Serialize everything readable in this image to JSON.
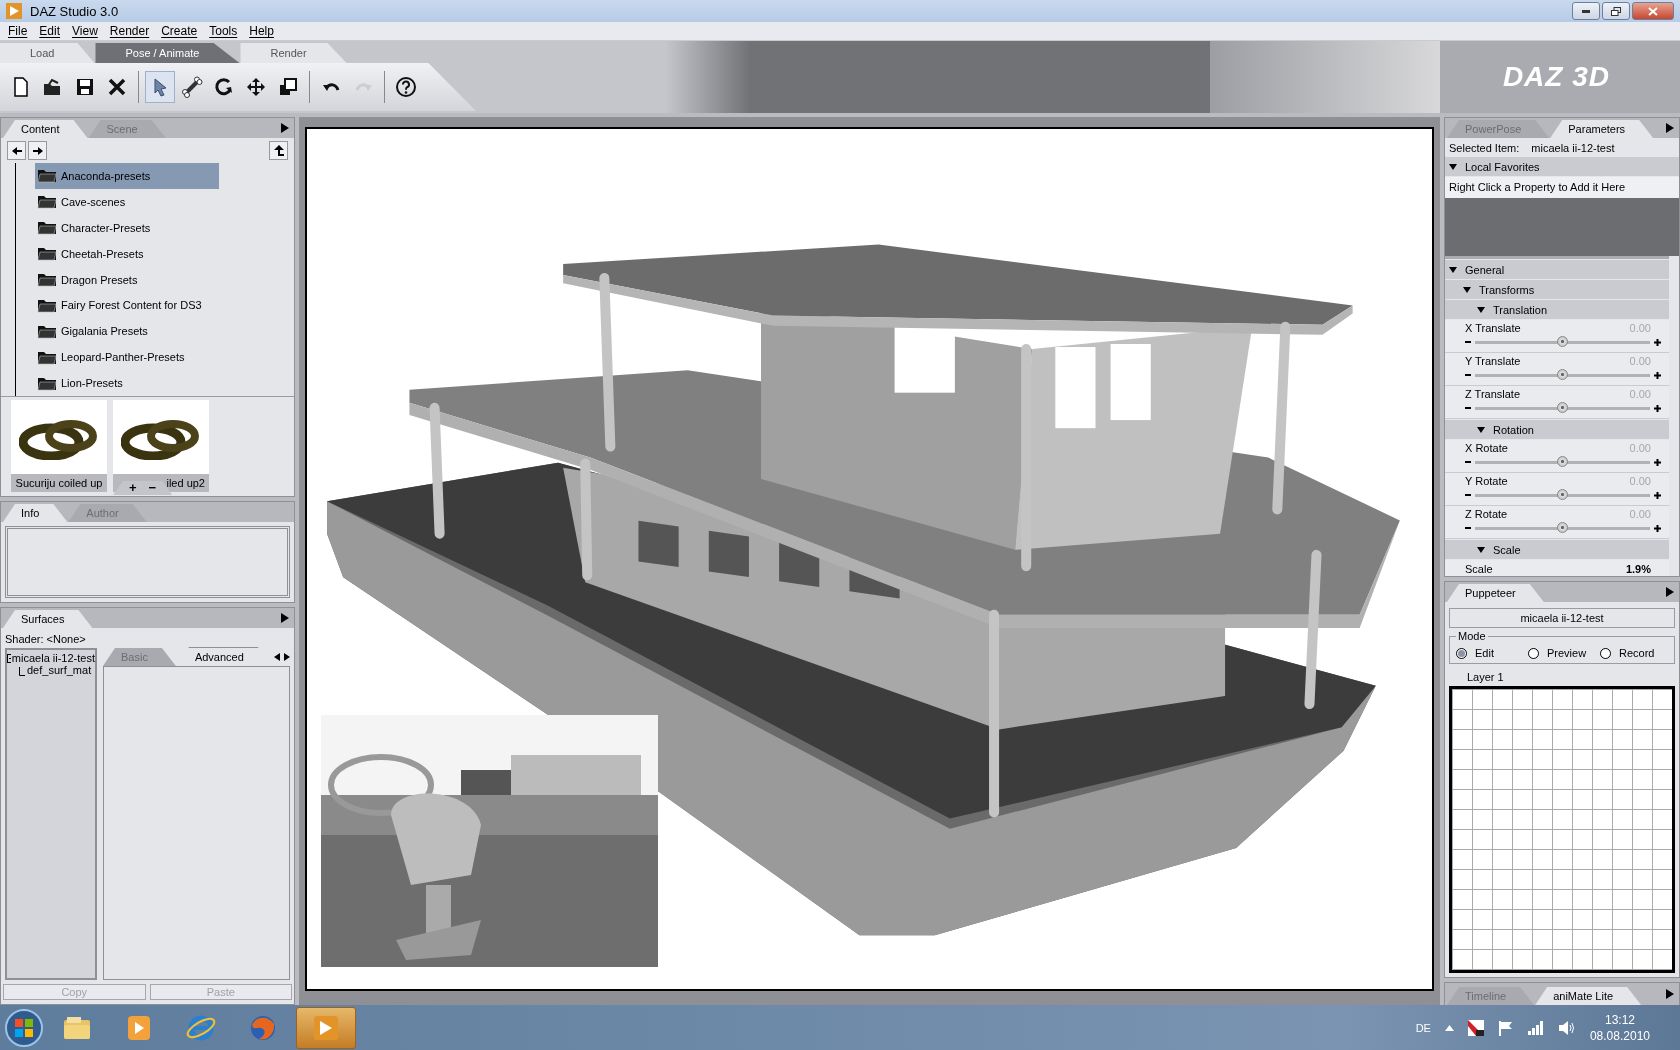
{
  "window": {
    "title": "DAZ Studio 3.0"
  },
  "menu": [
    "File",
    "Edit",
    "View",
    "Render",
    "Create",
    "Tools",
    "Help"
  ],
  "room_tabs": [
    {
      "label": "Load",
      "selected": false
    },
    {
      "label": "Pose / Animate",
      "selected": true
    },
    {
      "label": "Render",
      "selected": false
    }
  ],
  "toolbar": [
    {
      "kind": "new",
      "selected": false,
      "disabled": false
    },
    {
      "kind": "open",
      "selected": false,
      "disabled": false
    },
    {
      "kind": "save",
      "selected": false,
      "disabled": false
    },
    {
      "kind": "delete",
      "selected": false,
      "disabled": false
    },
    {
      "kind": "select",
      "selected": true,
      "disabled": false
    },
    {
      "kind": "bone",
      "selected": false,
      "disabled": false
    },
    {
      "kind": "rotate",
      "selected": false,
      "disabled": false
    },
    {
      "kind": "move",
      "selected": false,
      "disabled": false
    },
    {
      "kind": "scale",
      "selected": false,
      "disabled": false
    },
    {
      "kind": "undo",
      "selected": false,
      "disabled": false
    },
    {
      "kind": "redo",
      "selected": false,
      "disabled": true
    },
    {
      "kind": "help",
      "selected": false,
      "disabled": false
    }
  ],
  "banner": {
    "logo": "DAZ 3D"
  },
  "content_panel": {
    "tabs": [
      {
        "label": "Content",
        "selected": true
      },
      {
        "label": "Scene",
        "selected": false
      }
    ],
    "folders": [
      {
        "label": "Anaconda-presets",
        "selected": true
      },
      {
        "label": "Cave-scenes",
        "selected": false
      },
      {
        "label": "Character-Presets",
        "selected": false
      },
      {
        "label": "Cheetah-Presets",
        "selected": false
      },
      {
        "label": "Dragon Presets",
        "selected": false
      },
      {
        "label": "Fairy Forest Content for DS3",
        "selected": false
      },
      {
        "label": "Gigalania Presets",
        "selected": false
      },
      {
        "label": "Leopard-Panther-Presets",
        "selected": false
      },
      {
        "label": "Lion-Presets",
        "selected": false
      }
    ],
    "thumbnails": [
      {
        "label": "Sucuriju coiled up"
      },
      {
        "label": "iled up2"
      }
    ],
    "zoom_buttons": [
      "+",
      "−"
    ]
  },
  "info_panel": {
    "tabs": [
      {
        "label": "Info",
        "selected": true
      },
      {
        "label": "Author",
        "selected": false
      }
    ]
  },
  "surfaces_panel": {
    "tabs": [
      {
        "label": "Surfaces",
        "selected": true
      }
    ],
    "shader": "Shader: <None>",
    "tree": [
      {
        "label": "micaela ii-12-test",
        "expanded": true,
        "children": [
          {
            "label": "def_surf_mat"
          }
        ]
      }
    ],
    "editor_tabs": [
      {
        "label": "Basic",
        "selected": false
      },
      {
        "label": "Advanced",
        "selected": true
      }
    ],
    "buttons": [
      {
        "label": "Copy",
        "disabled": true
      },
      {
        "label": "Paste",
        "disabled": true
      }
    ]
  },
  "parameters_panel": {
    "tabs": [
      {
        "label": "PowerPose",
        "selected": false
      },
      {
        "label": "Parameters",
        "selected": true
      }
    ],
    "selected_item_label": "Selected Item:",
    "selected_item": "micaela ii-12-test",
    "favorites": {
      "title": "Local Favorites",
      "expanded": true,
      "hint": "Right Click a Property to Add it Here"
    },
    "properties": [
      {
        "kind": "group",
        "label": "General",
        "expanded": true,
        "children": [
          {
            "kind": "group",
            "label": "Transforms",
            "expanded": true,
            "children": [
              {
                "kind": "group",
                "label": "Translation",
                "expanded": true,
                "children": [
                  {
                    "kind": "slider",
                    "label": "X Translate",
                    "reading": "0.00",
                    "level": 0.5
                  },
                  {
                    "kind": "slider",
                    "label": "Y Translate",
                    "reading": "0.00",
                    "level": 0.5
                  },
                  {
                    "kind": "slider",
                    "label": "Z Translate",
                    "reading": "0.00",
                    "level": 0.5
                  }
                ]
              },
              {
                "kind": "group",
                "label": "Rotation",
                "expanded": true,
                "children": [
                  {
                    "kind": "slider",
                    "label": "X Rotate",
                    "reading": "0.00",
                    "level": 0.5
                  },
                  {
                    "kind": "slider",
                    "label": "Y Rotate",
                    "reading": "0.00",
                    "level": 0.5
                  },
                  {
                    "kind": "slider",
                    "label": "Z Rotate",
                    "reading": "0.00",
                    "level": 0.5
                  }
                ]
              },
              {
                "kind": "group",
                "label": "Scale",
                "expanded": true,
                "children": [
                  {
                    "kind": "value",
                    "label": "Scale",
                    "reading": "1.9%"
                  }
                ]
              }
            ]
          }
        ]
      }
    ]
  },
  "puppeteer_panel": {
    "tabs": [
      {
        "label": "Puppeteer",
        "selected": true
      }
    ],
    "node": "micaela ii-12-test",
    "mode_label": "Mode",
    "modes": [
      {
        "label": "Edit",
        "selected": true
      },
      {
        "label": "Preview",
        "selected": false
      },
      {
        "label": "Record",
        "selected": false
      }
    ],
    "layer_tabs": [
      {
        "label": "Layer 1",
        "selected": true
      }
    ]
  },
  "bottom_tabs": [
    {
      "label": "Timeline",
      "selected": false
    },
    {
      "label": "aniMate Lite",
      "selected": true
    }
  ],
  "taskbar": {
    "apps": [
      {
        "kind": "explorer",
        "selected": false
      },
      {
        "kind": "media",
        "selected": false
      },
      {
        "kind": "ie",
        "selected": false
      },
      {
        "kind": "firefox",
        "selected": false
      },
      {
        "kind": "daz",
        "selected": true
      }
    ],
    "language": "DE",
    "time": "13:12",
    "date": "08.08.2010"
  }
}
